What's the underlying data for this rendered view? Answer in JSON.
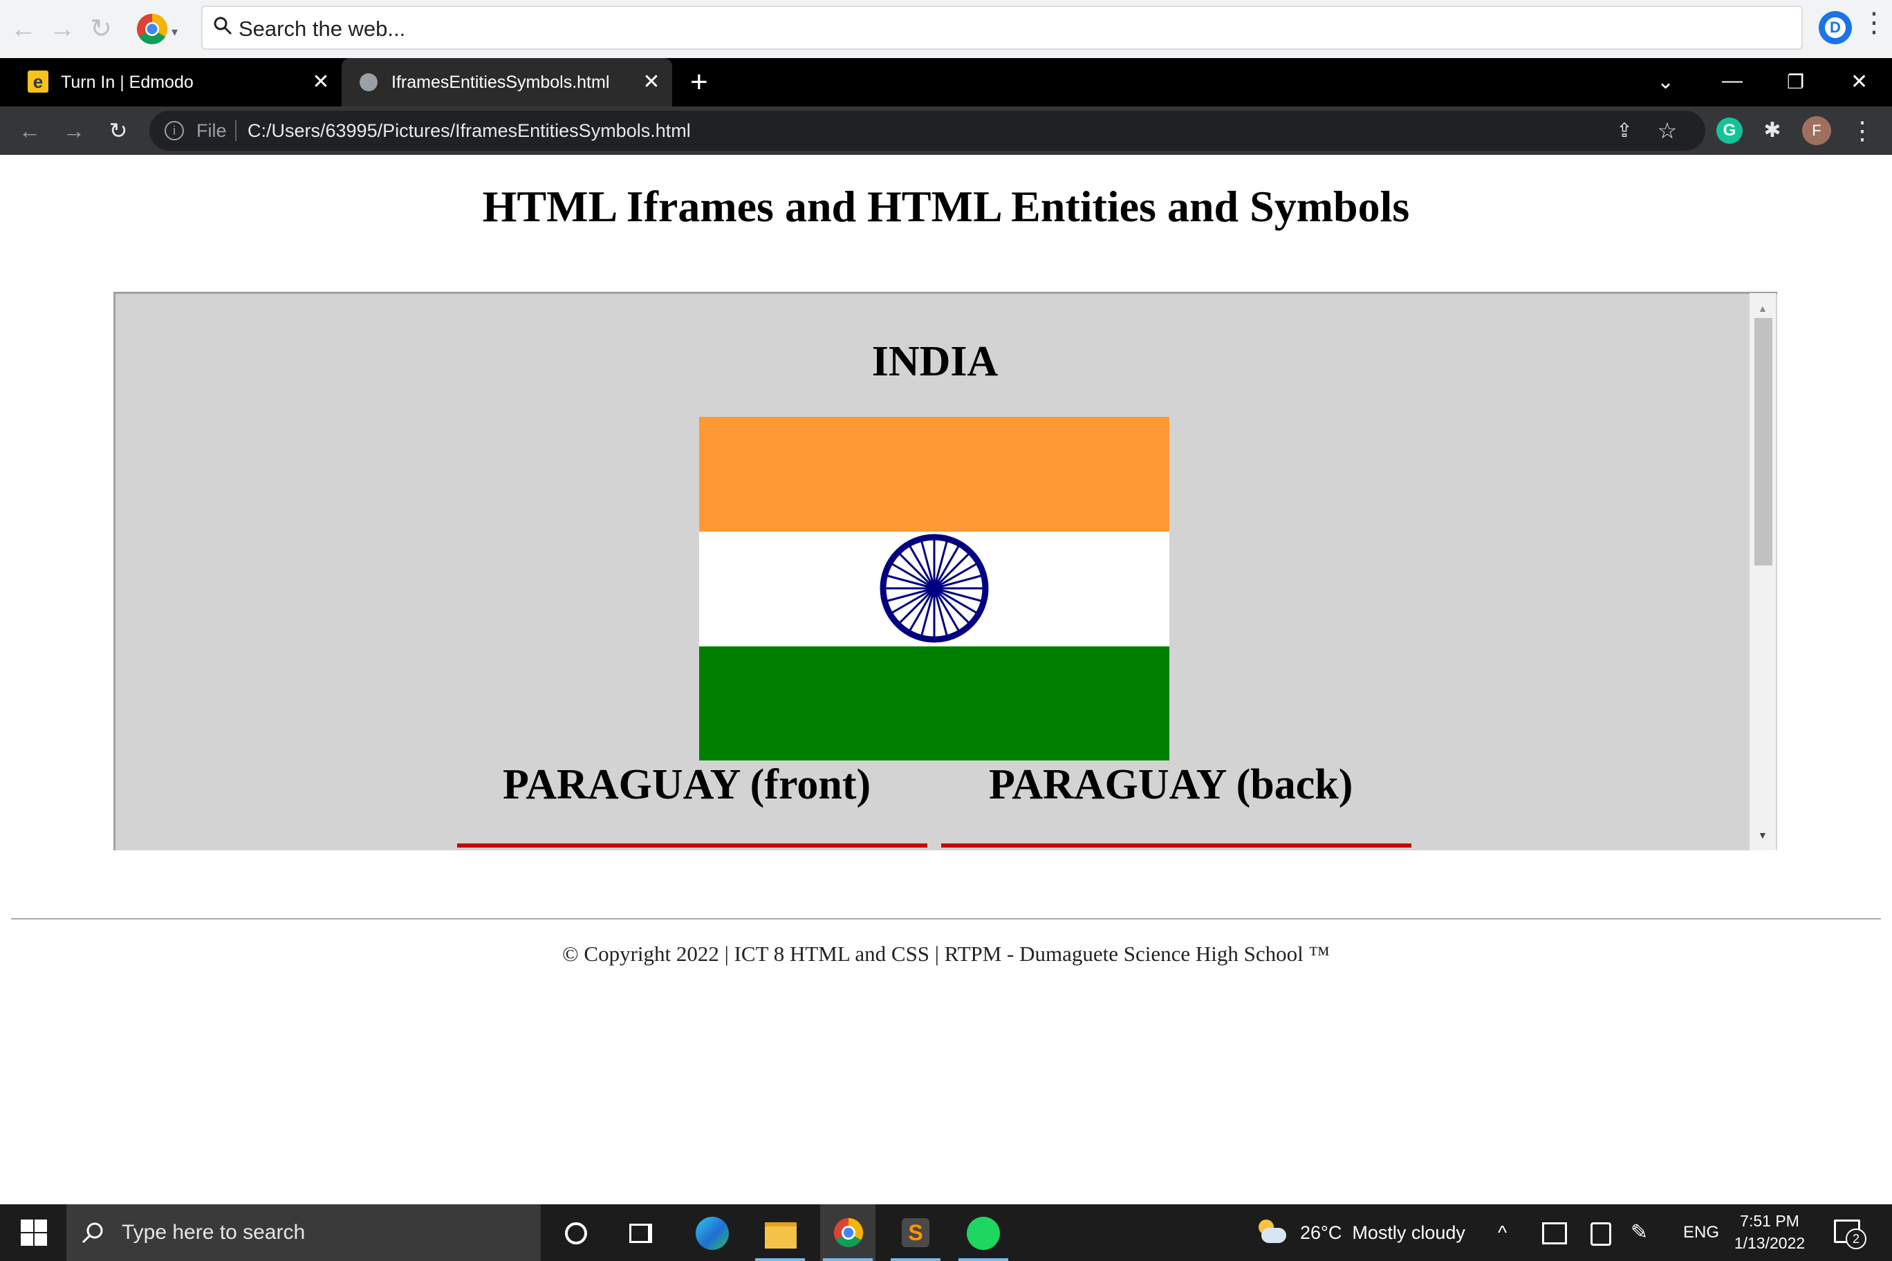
{
  "search_bar": {
    "placeholder": "Search the web..."
  },
  "tabs": [
    {
      "title": "Turn In | Edmodo",
      "favicon": "edmodo-icon"
    },
    {
      "title": "IframesEntitiesSymbols.html",
      "favicon": "globe-icon"
    }
  ],
  "address": {
    "scheme_label": "File",
    "url": "C:/Users/63995/Pictures/IframesEntitiesSymbols.html"
  },
  "profile": {
    "initial": "F"
  },
  "page": {
    "title": "HTML Iframes and HTML Entities and Symbols",
    "iframe": {
      "heading": "INDIA",
      "paraguay_front": "PARAGUAY (front)",
      "paraguay_back": "PARAGUAY (back)"
    },
    "footer": "© Copyright 2022 | ICT 8 HTML and CSS | RTPM - Dumaguete Science High School ™"
  },
  "colors": {
    "saffron": "#ff9933",
    "green": "#008000",
    "chakra_blue": "#000080",
    "iframe_bg": "#d3d3d3",
    "paraguay_red": "#c8000a"
  },
  "taskbar": {
    "search_placeholder": "Type here to search",
    "weather": "26°C  Mostly cloudy",
    "language": "ENG",
    "time": "7:51 PM",
    "date": "1/13/2022",
    "notification_count": "2"
  }
}
